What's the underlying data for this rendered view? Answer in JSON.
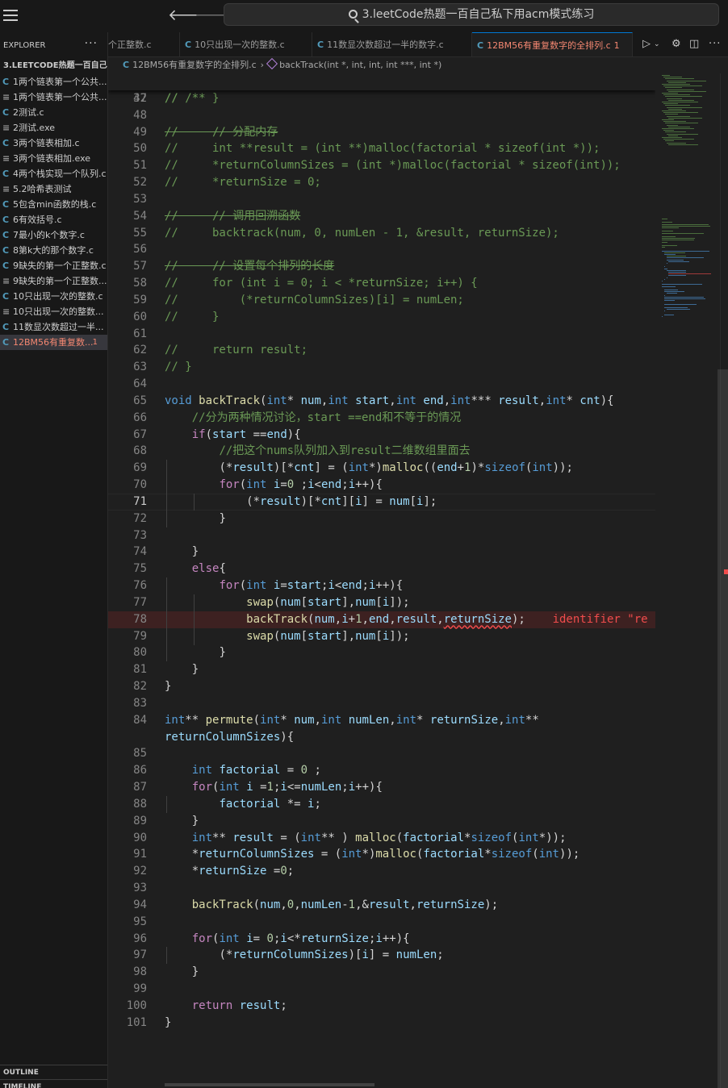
{
  "window": {
    "search_text": "3.leetCode热题一百自己私下用acm模式练习",
    "back_arrow": "🡐",
    "forward_arrow": "🡒"
  },
  "explorer": {
    "title": "EXPLORER",
    "more": "···",
    "folder": "3.LEETCODE热题一百自己私...",
    "files": [
      {
        "icon": "C",
        "name": "1两个链表第一个公共...",
        "type": "c"
      },
      {
        "icon": "≡",
        "name": "1两个链表第一个公共...",
        "type": "exe"
      },
      {
        "icon": "C",
        "name": "2测试.c",
        "type": "c"
      },
      {
        "icon": "≡",
        "name": "2测试.exe",
        "type": "exe"
      },
      {
        "icon": "C",
        "name": "3两个链表相加.c",
        "type": "c"
      },
      {
        "icon": "≡",
        "name": "3两个链表相加.exe",
        "type": "exe"
      },
      {
        "icon": "C",
        "name": "4两个栈实现一个队列.c",
        "type": "c"
      },
      {
        "icon": "≡",
        "name": "5.2哈希表测试",
        "type": "exe"
      },
      {
        "icon": "C",
        "name": "5包含min函数的栈.c",
        "type": "c"
      },
      {
        "icon": "C",
        "name": "6有效括号.c",
        "type": "c"
      },
      {
        "icon": "C",
        "name": "7最小的k个数字.c",
        "type": "c"
      },
      {
        "icon": "C",
        "name": "8第k大的那个数字.c",
        "type": "c"
      },
      {
        "icon": "C",
        "name": "9缺失的第一个正整数.c",
        "type": "c"
      },
      {
        "icon": "≡",
        "name": "9缺失的第一个正整数...",
        "type": "exe"
      },
      {
        "icon": "C",
        "name": "10只出现一次的整数.c",
        "type": "c"
      },
      {
        "icon": "≡",
        "name": "10只出现一次的整数...",
        "type": "exe"
      },
      {
        "icon": "C",
        "name": "11数显次数超过一半...",
        "type": "c"
      },
      {
        "icon": "C",
        "name": "12BM56有重复数...",
        "type": "c",
        "active": true,
        "errors": "1"
      }
    ],
    "outline": "OUTLINE",
    "timeline": "TIMELINE"
  },
  "tabs": [
    {
      "name": "个正整数.c",
      "icon": ""
    },
    {
      "name": "10只出现一次的整数.c",
      "icon": "C"
    },
    {
      "name": "11数显次数超过一半的数字.c",
      "icon": "C"
    },
    {
      "name": "12BM56有重复数字的全排列.c",
      "icon": "C",
      "active": true,
      "errors": "1"
    }
  ],
  "breadcrumb": {
    "icon": "C",
    "file": "12BM56有重复数字的全排列.c",
    "separator": "›",
    "symbol": "backTrack(int *, int, int, int ***, int *)"
  },
  "editor": {
    "sticky": {
      "ln": "32",
      "text": "// /**"
    },
    "lines": [
      {
        "ln": "47",
        "text": "//     }"
      },
      {
        "ln": "48",
        "text": ""
      },
      {
        "ln": "49",
        "text": "//     // 分配内存"
      },
      {
        "ln": "50",
        "text": "//     int **result = (int **)malloc(factorial * sizeof(int *));"
      },
      {
        "ln": "51",
        "text": "//     *returnColumnSizes = (int *)malloc(factorial * sizeof(int));"
      },
      {
        "ln": "52",
        "text": "//     *returnSize = 0;"
      },
      {
        "ln": "53",
        "text": ""
      },
      {
        "ln": "54",
        "text": "//     // 调用回溯函数"
      },
      {
        "ln": "55",
        "text": "//     backtrack(num, 0, numLen - 1, &result, returnSize);"
      },
      {
        "ln": "56",
        "text": ""
      },
      {
        "ln": "57",
        "text": "//     // 设置每个排列的长度"
      },
      {
        "ln": "58",
        "text": "//     for (int i = 0; i < *returnSize; i++) {"
      },
      {
        "ln": "59",
        "text": "//         (*returnColumnSizes)[i] = numLen;"
      },
      {
        "ln": "60",
        "text": "//     }"
      },
      {
        "ln": "61",
        "text": ""
      },
      {
        "ln": "62",
        "text": "//     return result;"
      },
      {
        "ln": "63",
        "text": "// }"
      },
      {
        "ln": "64",
        "text": ""
      },
      {
        "ln": "65",
        "text": "void backTrack(int* num,int start,int end,int*** result,int* cnt){"
      },
      {
        "ln": "66",
        "text": "    //分为两种情况讨论，start ==end和不等于的情况"
      },
      {
        "ln": "67",
        "text": "    if(start ==end){"
      },
      {
        "ln": "68",
        "text": "        //把这个nums队列加入到result二维数组里面去"
      },
      {
        "ln": "69",
        "text": "        (*result)[*cnt] = (int*)malloc((end+1)*sizeof(int));"
      },
      {
        "ln": "70",
        "text": "        for(int i=0 ;i<end;i++){"
      },
      {
        "ln": "71",
        "text": "            (*result)[*cnt][i] = num[i];"
      },
      {
        "ln": "72",
        "text": "        }"
      },
      {
        "ln": "73",
        "text": ""
      },
      {
        "ln": "74",
        "text": "    }"
      },
      {
        "ln": "75",
        "text": "    else{"
      },
      {
        "ln": "76",
        "text": "        for(int i=start;i<end;i++){"
      },
      {
        "ln": "77",
        "text": "            swap(num[start],num[i]);"
      },
      {
        "ln": "78",
        "text": "            backTrack(num,i+1,end,result,returnSize);    identifier \"re"
      },
      {
        "ln": "79",
        "text": "            swap(num[start],num[i]);"
      },
      {
        "ln": "80",
        "text": "        }"
      },
      {
        "ln": "81",
        "text": "    }"
      },
      {
        "ln": "82",
        "text": "}"
      },
      {
        "ln": "83",
        "text": ""
      },
      {
        "ln": "84",
        "text": "int** permute(int* num,int numLen,int* returnSize,int**"
      },
      {
        "ln": "",
        "text": "returnColumnSizes){"
      },
      {
        "ln": "85",
        "text": ""
      },
      {
        "ln": "86",
        "text": "    int factorial = 0 ;"
      },
      {
        "ln": "87",
        "text": "    for(int i =1;i<=numLen;i++){"
      },
      {
        "ln": "88",
        "text": "        factorial *= i;"
      },
      {
        "ln": "89",
        "text": "    }"
      },
      {
        "ln": "90",
        "text": "    int** result = (int** ) malloc(factorial*sizeof(int*));"
      },
      {
        "ln": "91",
        "text": "    *returnColumnSizes = (int*)malloc(factorial*sizeof(int));"
      },
      {
        "ln": "92",
        "text": "    *returnSize =0;"
      },
      {
        "ln": "93",
        "text": ""
      },
      {
        "ln": "94",
        "text": "    backTrack(num,0,numLen-1,&result,returnSize);"
      },
      {
        "ln": "95",
        "text": ""
      },
      {
        "ln": "96",
        "text": "    for(int i= 0;i<*returnSize;i++){"
      },
      {
        "ln": "97",
        "text": "        (*returnColumnSizes)[i] = numLen;"
      },
      {
        "ln": "98",
        "text": "    }"
      },
      {
        "ln": "99",
        "text": ""
      },
      {
        "ln": "100",
        "text": "    return result;"
      },
      {
        "ln": "101",
        "text": "}"
      }
    ]
  },
  "colors": {
    "background": "#1f1f1f",
    "sidebar": "#181818",
    "keyword": "#569cd6",
    "function": "#dcdcaa",
    "variable": "#9cdcfe",
    "comment": "#6a9955",
    "number": "#b5cea8",
    "error": "#f14c4c",
    "active_tab_text": "#f48771"
  }
}
